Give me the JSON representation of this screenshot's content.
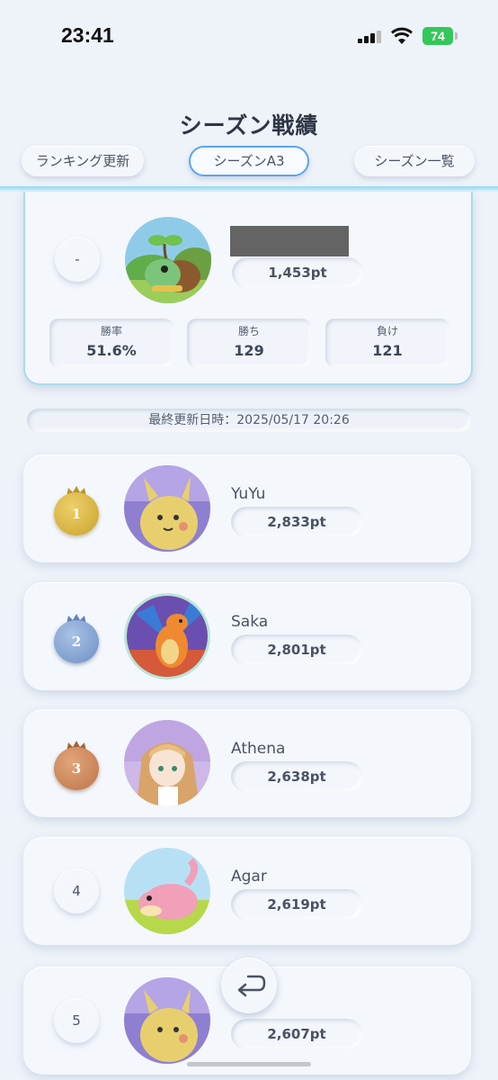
{
  "status_bar": {
    "time": "23:41",
    "battery": "74"
  },
  "title": "シーズン戦績",
  "tabs": [
    {
      "label": "ランキング更新"
    },
    {
      "label": "シーズンA3",
      "selected": true
    },
    {
      "label": "シーズン一覧"
    }
  ],
  "my_record": {
    "rank": "-",
    "points": "1,453pt",
    "stats": [
      {
        "label": "勝率",
        "value": "51.6%"
      },
      {
        "label": "勝ち",
        "value": "129"
      },
      {
        "label": "負け",
        "value": "121"
      }
    ]
  },
  "last_updated": "最終更新日時：2025/05/17 20:26",
  "rankings": [
    {
      "rank": "1",
      "name": "YuYu",
      "points": "2,833pt",
      "medal": "gold"
    },
    {
      "rank": "2",
      "name": "Saka",
      "points": "2,801pt",
      "medal": "silver"
    },
    {
      "rank": "3",
      "name": "Athena",
      "points": "2,638pt",
      "medal": "bronze"
    },
    {
      "rank": "4",
      "name": "Agar",
      "points": "2,619pt"
    },
    {
      "rank": "5",
      "name": "",
      "points": "2,607pt"
    }
  ],
  "colors": {
    "accent": "#5aa6ec",
    "gold": "#d4ae3a",
    "silver": "#7f9fd0",
    "bronze": "#c8845a"
  }
}
